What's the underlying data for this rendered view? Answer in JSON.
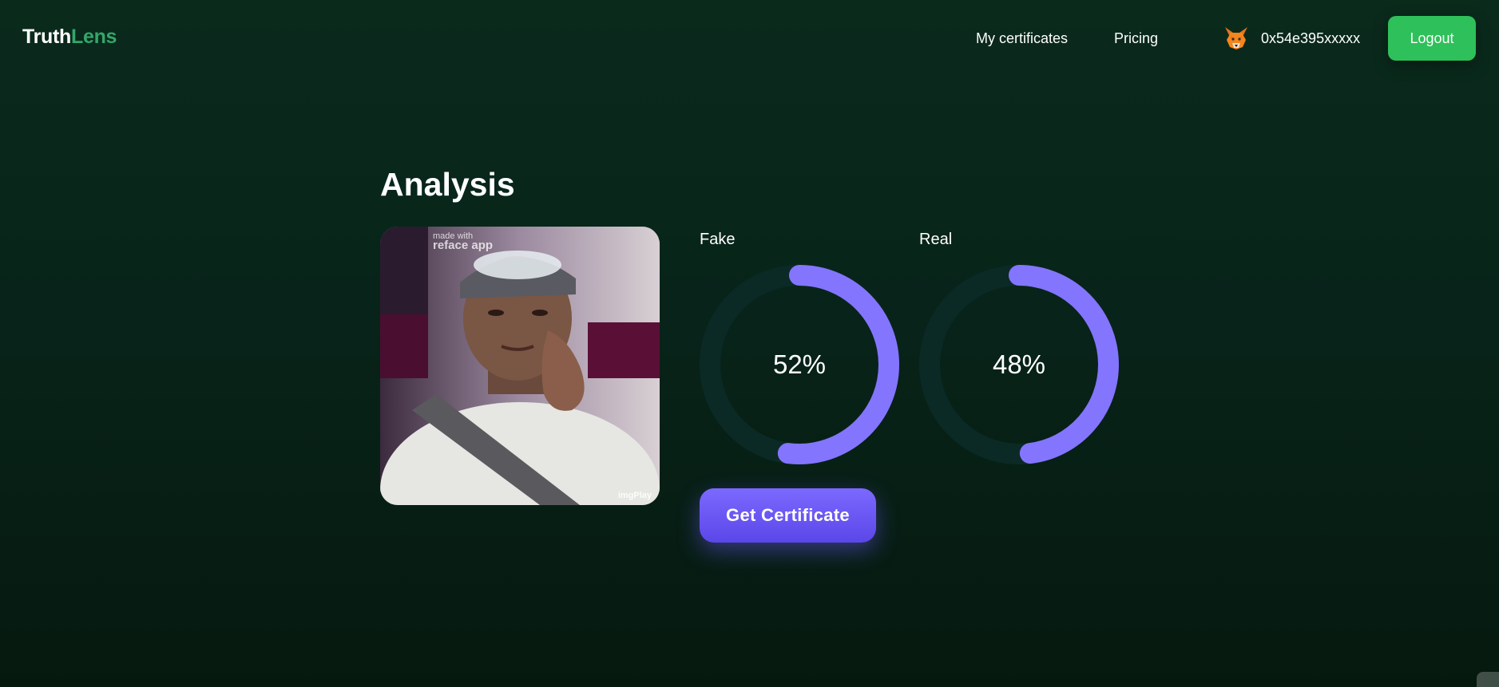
{
  "app": {
    "logo_part1": "Truth",
    "logo_part2": "Lens"
  },
  "nav": {
    "links": [
      {
        "label": "My certificates"
      },
      {
        "label": "Pricing"
      }
    ],
    "wallet_icon": "metamask-fox-icon",
    "wallet_address": "0x54e395xxxxx",
    "logout_label": "Logout"
  },
  "main": {
    "title": "Analysis",
    "media": {
      "watermark_top_line1": "made with",
      "watermark_top_line2": "reface app",
      "watermark_bottom": "imgPlay"
    },
    "results": [
      {
        "label": "Fake",
        "percent_text": "52%",
        "fraction": 0.52
      },
      {
        "label": "Real",
        "percent_text": "48%",
        "fraction": 0.48
      }
    ],
    "certificate_label": "Get Certificate"
  },
  "colors": {
    "background": "#0a2a1c",
    "brand_green": "#34a66a",
    "logout_green": "#2ec05a",
    "gauge_fill": "#8475ff",
    "gauge_track": "#0b2a26",
    "button_purple": "#6c58f5"
  }
}
